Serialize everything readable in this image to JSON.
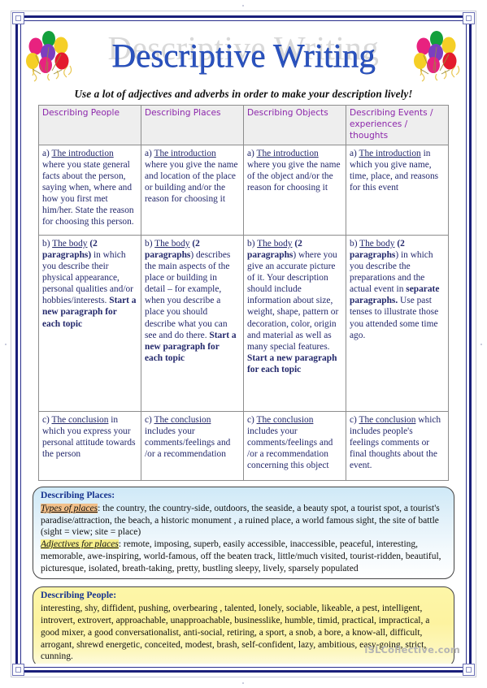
{
  "document": {
    "title": "Descriptive Writing",
    "subtitle": "Use a lot of adjectives and adverbs in order to make your description lively!",
    "watermark": "iSLCollective.com"
  },
  "colors": {
    "title_blue": "#2a52be",
    "header_purple": "#8c27ab",
    "body_navy": "#23286b",
    "border_navy": "#1a1f7a",
    "places_box": "#cfe9f7",
    "people_box": "#fdf6a8",
    "highlight_orange": "#f2c08a",
    "highlight_yellow": "#f7ef8c"
  },
  "table": {
    "headers": [
      "Describing People",
      "Describing Places",
      "Describing Objects",
      "Describing Events / experiences / thoughts"
    ],
    "rows": [
      {
        "key": "introduction",
        "cells": [
          {
            "marker": "a)",
            "underlined": "The introduction",
            "text": " where you state general facts about the person, saying when, where and how you first met him/her. State the reason for choosing this person."
          },
          {
            "marker": "a)",
            "underlined": "The introduction",
            "text": " where you give the name and location of the place or building and/or the reason for choosing it"
          },
          {
            "marker": "a)",
            "underlined": "The introduction",
            "text": " where you give the name of the object and/or the reason for choosing it"
          },
          {
            "marker": "a)",
            "underlined": "The introduction",
            "text": " in which you give name, time, place, and reasons for this event"
          }
        ]
      },
      {
        "key": "body",
        "cells": [
          {
            "marker": "b)",
            "underlined": "The body",
            "bold_lead": " (2 paragraphs)",
            "text": " in which you describe their physical appearance, personal qualities and/or hobbies/interests. ",
            "bold_tail": "Start a new paragraph for each topic"
          },
          {
            "marker": "b)",
            "underlined": "The body",
            "bold_lead": " (2 paragraphs",
            "text": ") describes the main aspects of the place or building in detail – for example, when you describe a place you should describe what you can see and do there. ",
            "bold_tail": "Start a new paragraph for each topic"
          },
          {
            "marker": "b)",
            "underlined": "The body",
            "bold_lead": " (2 paragraphs",
            "text": ") where you give an accurate picture of it. Your description should include information about size, weight, shape, pattern or decoration, color, origin and material as well as many special features. ",
            "bold_tail": "Start a new paragraph for each topic"
          },
          {
            "marker": "b)",
            "underlined": "The body",
            "bold_lead": " (2 paragraphs",
            "text": ") in which you describe the preparations and the actual event in ",
            "bold_mid": "separate paragraphs.",
            "text2": " Use past tenses to illustrate those you attended some time ago."
          }
        ]
      },
      {
        "key": "conclusion",
        "cells": [
          {
            "marker": "c)",
            "underlined": "The conclusion",
            "text": " in which you express your personal attitude towards the person"
          },
          {
            "marker": "c)",
            "underlined": "The conclusion",
            "text": " includes your comments/feelings and /or a recommendation"
          },
          {
            "marker": "c)",
            "underlined": "The conclusion",
            "text": " includes your comments/feelings and /or a recommendation concerning this object"
          },
          {
            "marker": "c)",
            "underlined": "The conclusion",
            "text": " which includes people's feelings comments or final thoughts about the event."
          }
        ]
      }
    ]
  },
  "notes": [
    {
      "key": "describing-places",
      "title": "Describing Places:",
      "lines": [
        {
          "label": "Types of places",
          "label_style": "orange",
          "text": ": the country, the country-side, outdoors, the seaside, a beauty spot, a tourist spot, a tourist's paradise/attraction, the beach, a historic monument , a ruined place, a world famous sight, the site of battle (sight = view; site = place)"
        },
        {
          "label": "Adjectives for places",
          "label_style": "yellow",
          "text": ": remote, imposing,  superb, easily accessible, inaccessible, peaceful, interesting, memorable, awe-inspiring, world-famous, off the beaten track, little/much visited, tourist-ridden, beautiful, picturesque, isolated, breath-taking, pretty, bustling sleepy, lively, sparsely populated"
        }
      ]
    },
    {
      "key": "describing-people",
      "title": "Describing People:",
      "lines": [
        {
          "label": "",
          "label_style": "none",
          "text": "interesting, shy, diffident, pushing, overbearing , talented, lonely, sociable, likeable, a pest, intelligent, introvert, extrovert, approachable, unapproachable, businesslike, humble, timid, practical, impractical, a good mixer, a good conversationalist, anti-social, retiring, a sport, a snob, a bore, a know-all, difficult, arrogant, shrewd energetic, conceited, modest, brash, self-confident, lazy, ambitious, easy-going, strict, cunning."
        }
      ]
    }
  ]
}
